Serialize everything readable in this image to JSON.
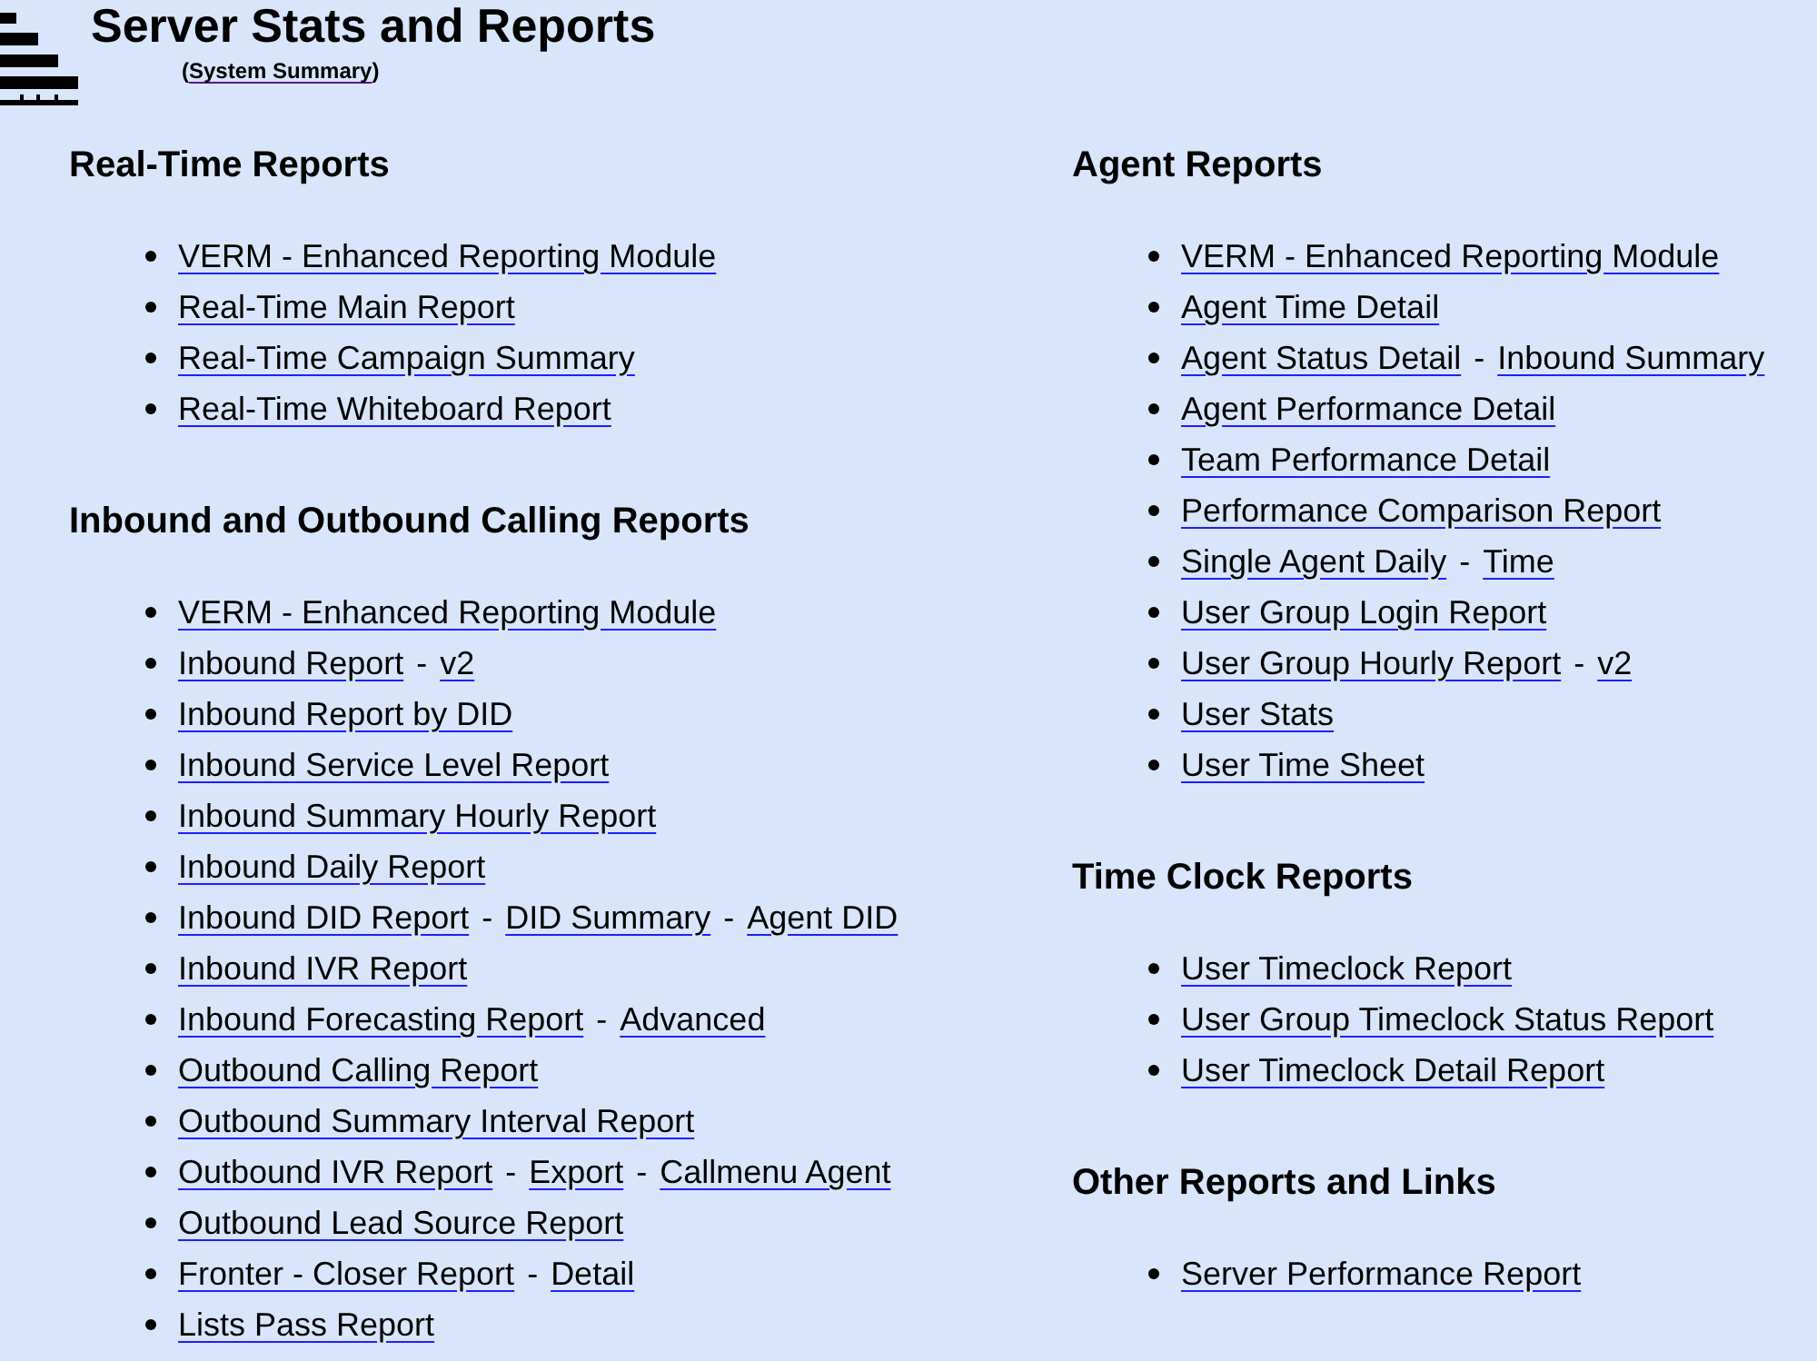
{
  "header": {
    "title": "Server Stats and Reports",
    "subtitle": {
      "open": "(",
      "link": "System Summary",
      "close": ")"
    }
  },
  "columns": [
    {
      "sections": [
        {
          "heading": "Real-Time Reports",
          "items": [
            {
              "parts": [
                {
                  "kind": "link",
                  "text": "VERM - Enhanced Reporting Module"
                }
              ]
            },
            {
              "parts": [
                {
                  "kind": "link",
                  "text": "Real-Time Main Report"
                }
              ]
            },
            {
              "parts": [
                {
                  "kind": "link",
                  "text": "Real-Time Campaign Summary"
                }
              ]
            },
            {
              "parts": [
                {
                  "kind": "link",
                  "text": "Real-Time Whiteboard Report"
                }
              ]
            }
          ]
        },
        {
          "heading": "Inbound and Outbound Calling Reports",
          "items": [
            {
              "parts": [
                {
                  "kind": "link",
                  "text": "VERM - Enhanced Reporting Module"
                }
              ]
            },
            {
              "parts": [
                {
                  "kind": "link",
                  "text": "Inbound Report"
                },
                {
                  "kind": "text",
                  "text": "-"
                },
                {
                  "kind": "link",
                  "text": "v2"
                }
              ]
            },
            {
              "parts": [
                {
                  "kind": "link",
                  "text": "Inbound Report by DID"
                }
              ]
            },
            {
              "parts": [
                {
                  "kind": "link",
                  "text": "Inbound Service Level Report"
                }
              ]
            },
            {
              "parts": [
                {
                  "kind": "link",
                  "text": "Inbound Summary Hourly Report"
                }
              ]
            },
            {
              "parts": [
                {
                  "kind": "link",
                  "text": "Inbound Daily Report"
                }
              ]
            },
            {
              "parts": [
                {
                  "kind": "link",
                  "text": "Inbound DID Report"
                },
                {
                  "kind": "text",
                  "text": "-"
                },
                {
                  "kind": "link",
                  "text": "DID Summary"
                },
                {
                  "kind": "text",
                  "text": "-"
                },
                {
                  "kind": "link",
                  "text": "Agent DID"
                }
              ]
            },
            {
              "parts": [
                {
                  "kind": "link",
                  "text": "Inbound IVR Report"
                }
              ]
            },
            {
              "parts": [
                {
                  "kind": "link",
                  "text": "Inbound Forecasting Report"
                },
                {
                  "kind": "text",
                  "text": "-"
                },
                {
                  "kind": "link",
                  "text": "Advanced"
                }
              ]
            },
            {
              "parts": [
                {
                  "kind": "link",
                  "text": "Outbound Calling Report"
                }
              ]
            },
            {
              "parts": [
                {
                  "kind": "link",
                  "text": "Outbound Summary Interval Report"
                }
              ]
            },
            {
              "parts": [
                {
                  "kind": "link",
                  "text": "Outbound IVR Report"
                },
                {
                  "kind": "text",
                  "text": "-"
                },
                {
                  "kind": "link",
                  "text": "Export"
                },
                {
                  "kind": "text",
                  "text": "-"
                },
                {
                  "kind": "link",
                  "text": "Callmenu Agent"
                }
              ]
            },
            {
              "parts": [
                {
                  "kind": "link",
                  "text": "Outbound Lead Source Report"
                }
              ]
            },
            {
              "parts": [
                {
                  "kind": "link",
                  "text": "Fronter - Closer Report"
                },
                {
                  "kind": "text",
                  "text": "-"
                },
                {
                  "kind": "link",
                  "text": "Detail"
                }
              ]
            },
            {
              "parts": [
                {
                  "kind": "link",
                  "text": "Lists Pass Report"
                }
              ]
            }
          ]
        }
      ]
    },
    {
      "sections": [
        {
          "heading": "Agent Reports",
          "items": [
            {
              "parts": [
                {
                  "kind": "link",
                  "text": "VERM - Enhanced Reporting Module"
                }
              ]
            },
            {
              "parts": [
                {
                  "kind": "link",
                  "text": "Agent Time Detail"
                }
              ]
            },
            {
              "parts": [
                {
                  "kind": "link",
                  "text": "Agent Status Detail"
                },
                {
                  "kind": "text",
                  "text": "-"
                },
                {
                  "kind": "link",
                  "text": "Inbound Summary"
                }
              ]
            },
            {
              "parts": [
                {
                  "kind": "link",
                  "text": "Agent Performance Detail"
                }
              ]
            },
            {
              "parts": [
                {
                  "kind": "link",
                  "text": "Team Performance Detail"
                }
              ]
            },
            {
              "parts": [
                {
                  "kind": "link",
                  "text": "Performance Comparison Report"
                }
              ]
            },
            {
              "parts": [
                {
                  "kind": "link",
                  "text": "Single Agent Daily"
                },
                {
                  "kind": "text",
                  "text": "-"
                },
                {
                  "kind": "link",
                  "text": "Time"
                }
              ]
            },
            {
              "parts": [
                {
                  "kind": "link",
                  "text": "User Group Login Report"
                }
              ]
            },
            {
              "parts": [
                {
                  "kind": "link",
                  "text": "User Group Hourly Report"
                },
                {
                  "kind": "text",
                  "text": "-"
                },
                {
                  "kind": "link",
                  "text": "v2"
                }
              ]
            },
            {
              "parts": [
                {
                  "kind": "link",
                  "text": "User Stats"
                }
              ]
            },
            {
              "parts": [
                {
                  "kind": "link",
                  "text": "User Time Sheet"
                }
              ]
            }
          ]
        },
        {
          "heading": "Time Clock Reports",
          "items": [
            {
              "parts": [
                {
                  "kind": "link",
                  "text": "User Timeclock Report"
                }
              ]
            },
            {
              "parts": [
                {
                  "kind": "link",
                  "text": "User Group Timeclock Status Report"
                }
              ]
            },
            {
              "parts": [
                {
                  "kind": "link",
                  "text": "User Timeclock Detail Report"
                }
              ]
            }
          ]
        },
        {
          "heading": "Other Reports and Links",
          "items": [
            {
              "parts": [
                {
                  "kind": "link",
                  "text": "Server Performance Report"
                }
              ]
            }
          ]
        }
      ]
    }
  ]
}
